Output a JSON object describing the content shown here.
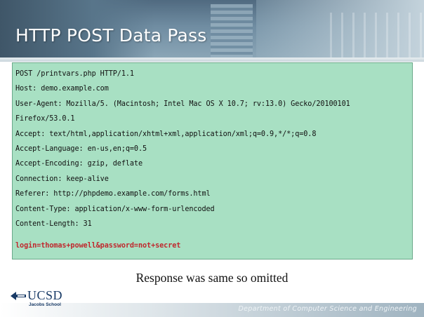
{
  "slide": {
    "title": "HTTP POST Data Pass",
    "request_lines": [
      "POST /printvars.php HTTP/1.1",
      "Host: demo.example.com",
      "User-Agent: Mozilla/5. (Macintosh; Intel Mac OS X 10.7; rv:13.0) Gecko/20100101",
      "Firefox/53.0.1",
      "Accept: text/html,application/xhtml+xml,application/xml;q=0.9,*/*;q=0.8",
      "Accept-Language: en-us,en;q=0.5",
      "Accept-Encoding: gzip, deflate",
      "Connection: keep-alive",
      "Referer: http://phpdemo.example.com/forms.html",
      "Content-Type: application/x-www-form-urlencoded",
      "Content-Length: 31"
    ],
    "request_body": "login=thomas+powell&password=not+secret",
    "caption": "Response was same so omitted",
    "footer": "Department of Computer Science and Engineering",
    "logo": {
      "wordmark": "UCSD",
      "subtitle": "Jacobs School"
    }
  },
  "colors": {
    "code_background": "#a8e0c3",
    "body_text": "#c0282e",
    "logo_blue": "#183a66"
  }
}
